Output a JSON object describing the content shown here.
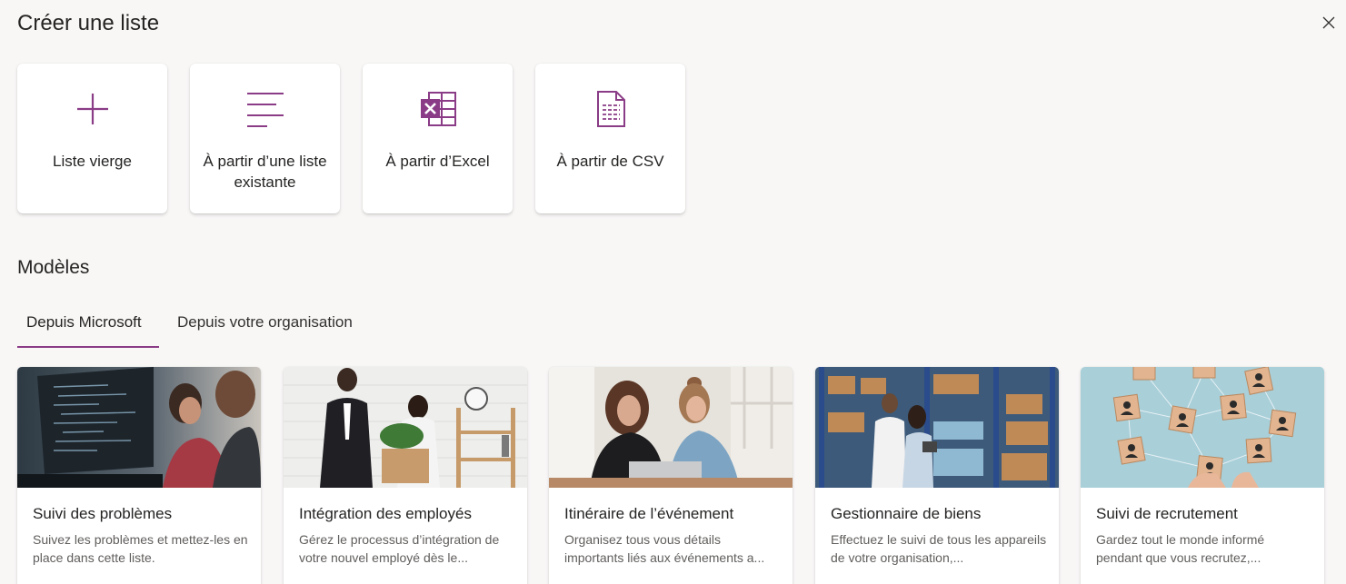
{
  "dialog": {
    "title": "Créer une liste",
    "close_icon": "close-icon"
  },
  "create_options": [
    {
      "label": "Liste vierge",
      "icon": "plus-icon"
    },
    {
      "label": "À partir d’une liste existante",
      "icon": "list-lines-icon"
    },
    {
      "label": "À partir d’Excel",
      "icon": "excel-icon"
    },
    {
      "label": "À partir de CSV",
      "icon": "csv-file-icon"
    }
  ],
  "templates_section": {
    "title": "Modèles",
    "tabs": [
      {
        "label": "Depuis Microsoft",
        "active": true
      },
      {
        "label": "Depuis votre organisation",
        "active": false
      }
    ]
  },
  "templates": [
    {
      "title": "Suivi des problèmes",
      "description": "Suivez les problèmes et mettez-les en place dans cette liste.",
      "image": "developers-at-computer-photo"
    },
    {
      "title": "Intégration des employés",
      "description": "Gérez le processus d’intégration de votre nouvel employé dès le...",
      "image": "new-employee-welcome-photo"
    },
    {
      "title": "Itinéraire de l’événement",
      "description": "Organisez tous vous détails importants liés aux événements a...",
      "image": "two-women-laptop-photo"
    },
    {
      "title": "Gestionnaire de biens",
      "description": "Effectuez le suivi de tous les appareils de votre organisation,...",
      "image": "warehouse-photo"
    },
    {
      "title": "Suivi de recrutement",
      "description": "Gardez tout le monde informé pendant que vous recrutez,...",
      "image": "recruiting-network-photo"
    }
  ],
  "colors": {
    "accent": "#8a3c86",
    "background": "#f8f7f6",
    "card": "#ffffff"
  }
}
